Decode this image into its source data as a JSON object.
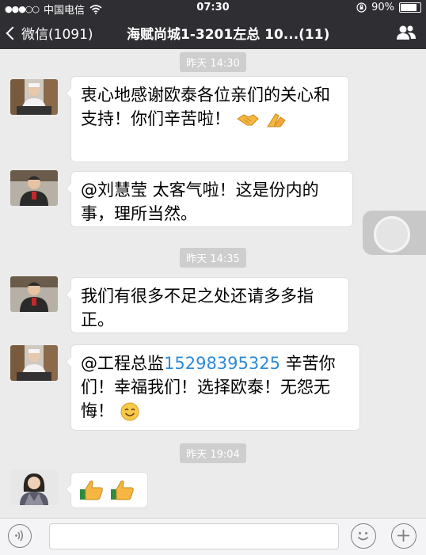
{
  "status_bar": {
    "carrier": "中国电信",
    "time": "07:30",
    "battery": "90%",
    "battery_level": 0.9
  },
  "nav": {
    "back_label": "微信(1091)",
    "title": "海赋尚城1-3201左总  10...(11)"
  },
  "messages": [
    {
      "time": "昨天 14:30",
      "text": "衷心地感谢欧泰各位亲们的关心和支持！你们辛苦啦！"
    },
    {
      "text": "@刘慧莹 太客气啦！这是份内的事，理所当然。"
    },
    {
      "time": "昨天 14:35",
      "text": "我们有很多不足之处还请多多指正。"
    },
    {
      "text_before": "@工程总监",
      "phone": "15298395325",
      "text_after": " 辛苦你们！幸福我们！选择欧泰！无怨无悔！"
    },
    {
      "time": "昨天 19:04"
    }
  ],
  "colors": {
    "nav_bg": "#2e2e33",
    "chat_bg": "#ebebeb",
    "link": "#2d8bd8",
    "timestamp_bg": "#cecece"
  }
}
